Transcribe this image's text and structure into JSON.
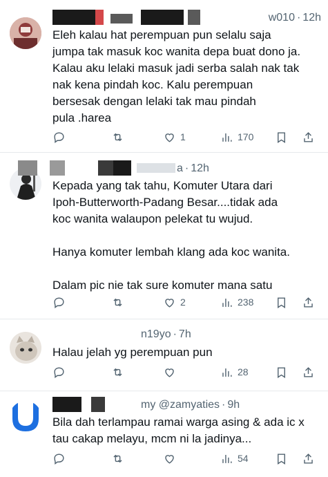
{
  "tweets": [
    {
      "handle": "w010",
      "time": "12h",
      "text": "Eleh kalau hat perempuan pun selalu saja\njumpa tak masuk koc wanita depa buat dono ja.\nKalau aku lelaki masuk jadi serba salah nak tak\nnak kena pindah koc. Kalu perempuan\nbersesak dengan lelaki tak mau pindah\npula .harea",
      "replies": "",
      "reposts": "",
      "likes": "1",
      "views": "170"
    },
    {
      "handle": "a",
      "time": "12h",
      "text": "Kepada yang tak tahu, Komuter Utara dari\nIpoh-Butterworth-Padang Besar....tidak ada\nkoc wanita walaupon pelekat tu wujud.\n\nHanya komuter lembah klang ada koc wanita.\n\nDalam pic nie tak sure komuter mana satu",
      "replies": "",
      "reposts": "",
      "likes": "2",
      "views": "238"
    },
    {
      "handle": "n19yo",
      "time": "7h",
      "text": "Halau jelah yg perempuan pun",
      "replies": "",
      "reposts": "",
      "likes": "",
      "views": "28"
    },
    {
      "handle": "my @zamyaties",
      "time": "9h",
      "text": "Bila dah terlampau ramai warga asing & ada ic x\ntau cakap melayu, mcm ni la jadinya...",
      "replies": "",
      "reposts": "",
      "likes": "",
      "views": "54"
    }
  ],
  "separator": "·",
  "icons": [
    "reply-icon",
    "repost-icon",
    "like-icon",
    "views-icon",
    "bookmark-icon",
    "share-icon"
  ],
  "colors": {
    "text": "#0f1419",
    "muted": "#536471",
    "divider": "#e6e9ec",
    "redaction": "#1a1a1a",
    "avatar_blue": "#1d6fe0"
  }
}
